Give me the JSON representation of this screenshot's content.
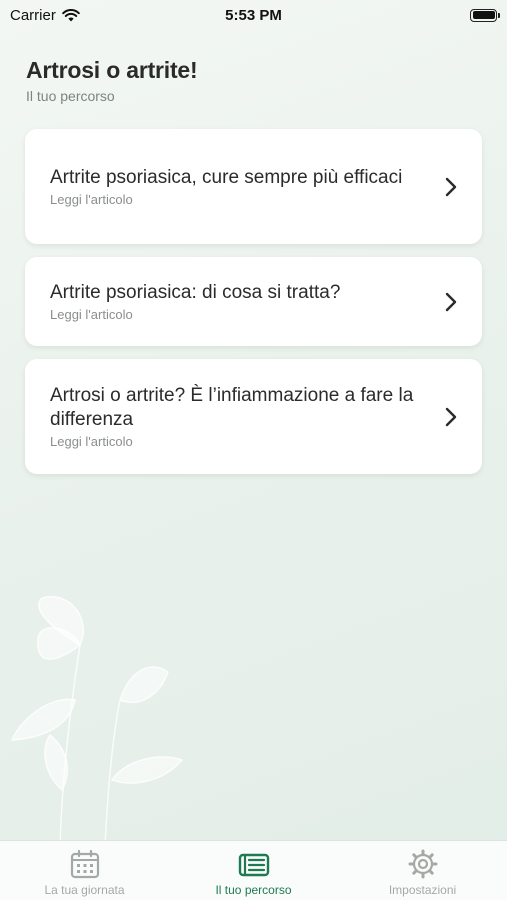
{
  "status_bar": {
    "carrier": "Carrier",
    "time": "5:53 PM"
  },
  "header": {
    "title": "Artrosi o artrite!",
    "subtitle": "Il tuo percorso"
  },
  "articles": [
    {
      "title": "Artrite psoriasica, cure sempre più efficaci",
      "action": "Leggi l'articolo"
    },
    {
      "title": "Artrite psoriasica: di cosa si tratta?",
      "action": "Leggi l'articolo"
    },
    {
      "title": "Artrosi o artrite? È l’infiammazione a fare la differenza",
      "action": "Leggi l'articolo"
    }
  ],
  "tabs": [
    {
      "label": "La tua giornata",
      "icon": "calendar-icon",
      "active": false
    },
    {
      "label": "Il tuo percorso",
      "icon": "newspaper-icon",
      "active": true
    },
    {
      "label": "Impostazioni",
      "icon": "gear-icon",
      "active": false
    }
  ],
  "colors": {
    "accent": "#1f7a52",
    "inactive": "#a3aaa6",
    "background": "#eaf2ed"
  }
}
